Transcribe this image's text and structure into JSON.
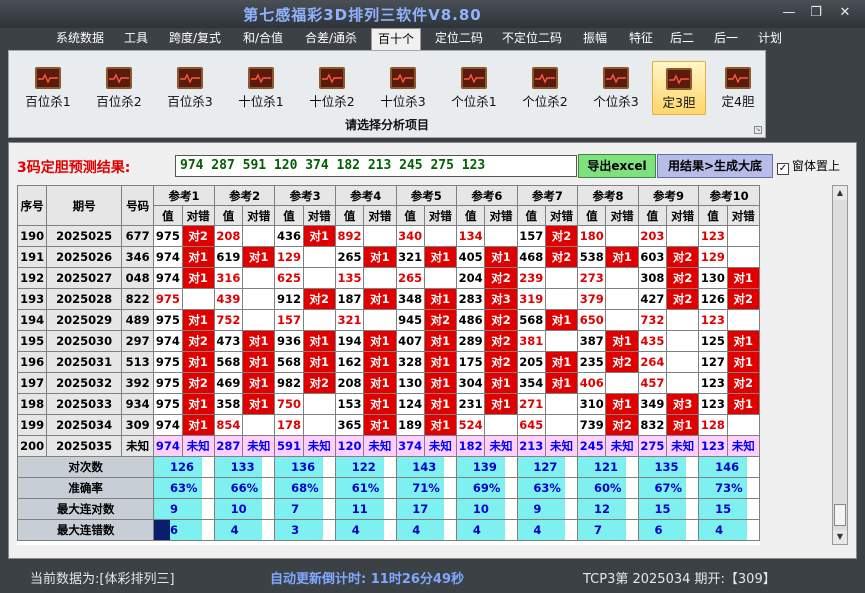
{
  "window": {
    "title": "第七感福彩3D排列三软件V8.80",
    "minimize": "—",
    "restore": "❐",
    "close": "✕"
  },
  "menu": [
    {
      "label": "系统数据"
    },
    {
      "label": "工具"
    },
    {
      "label": "跨度/复式"
    },
    {
      "label": "和/合值"
    },
    {
      "label": "合差/通杀"
    },
    {
      "label": "百十个",
      "active": true
    },
    {
      "label": "定位二码"
    },
    {
      "label": "不定位二码"
    },
    {
      "label": "振幅"
    },
    {
      "label": "特征"
    },
    {
      "label": "后二"
    },
    {
      "label": "后一"
    },
    {
      "label": "计划"
    }
  ],
  "ribbon": {
    "caption": "请选择分析项目",
    "buttons": [
      {
        "label": "百位杀1"
      },
      {
        "label": "百位杀2"
      },
      {
        "label": "百位杀3"
      },
      {
        "label": "十位杀1"
      },
      {
        "label": "十位杀2"
      },
      {
        "label": "十位杀3"
      },
      {
        "label": "个位杀1"
      },
      {
        "label": "个位杀2"
      },
      {
        "label": "个位杀3"
      },
      {
        "label": "定3胆",
        "active": true
      },
      {
        "label": "定4胆"
      }
    ]
  },
  "prediction": {
    "label": "3码定胆预测结果:",
    "result": "974 287 591 120 374 182 213 245 275 123",
    "export_button": "导出excel",
    "generate_button": "用结果>生成大底",
    "ontop_label": "窗体置上",
    "ontop_checked": "✓"
  },
  "table": {
    "headers": {
      "seq": "序号",
      "issue": "期号",
      "code": "号码",
      "value": "值",
      "check": "对错"
    },
    "refs": [
      "参考1",
      "参考2",
      "参考3",
      "参考4",
      "参考5",
      "参考6",
      "参考7",
      "参考8",
      "参考9",
      "参考10"
    ],
    "rows": [
      {
        "seq": "190",
        "issue": "2025025",
        "code": "677",
        "cells": [
          [
            "975",
            "对2"
          ],
          [
            "208",
            ""
          ],
          [
            "436",
            "对1"
          ],
          [
            "892",
            ""
          ],
          [
            "340",
            ""
          ],
          [
            "134",
            ""
          ],
          [
            "157",
            "对2"
          ],
          [
            "180",
            ""
          ],
          [
            "203",
            ""
          ],
          [
            "123",
            ""
          ]
        ]
      },
      {
        "seq": "191",
        "issue": "2025026",
        "code": "346",
        "cells": [
          [
            "974",
            "对1"
          ],
          [
            "619",
            "对1"
          ],
          [
            "129",
            ""
          ],
          [
            "265",
            "对1"
          ],
          [
            "321",
            "对1"
          ],
          [
            "405",
            "对1"
          ],
          [
            "468",
            "对2"
          ],
          [
            "538",
            "对1"
          ],
          [
            "603",
            "对2"
          ],
          [
            "129",
            ""
          ]
        ]
      },
      {
        "seq": "192",
        "issue": "2025027",
        "code": "048",
        "cells": [
          [
            "974",
            "对1"
          ],
          [
            "316",
            ""
          ],
          [
            "625",
            ""
          ],
          [
            "135",
            ""
          ],
          [
            "265",
            ""
          ],
          [
            "204",
            "对2"
          ],
          [
            "239",
            ""
          ],
          [
            "273",
            ""
          ],
          [
            "308",
            "对2"
          ],
          [
            "130",
            "对1"
          ]
        ]
      },
      {
        "seq": "193",
        "issue": "2025028",
        "code": "822",
        "cells": [
          [
            "975",
            ""
          ],
          [
            "439",
            ""
          ],
          [
            "912",
            "对2"
          ],
          [
            "187",
            "对1"
          ],
          [
            "348",
            "对1"
          ],
          [
            "283",
            "对3"
          ],
          [
            "319",
            ""
          ],
          [
            "379",
            ""
          ],
          [
            "427",
            "对2"
          ],
          [
            "126",
            "对2"
          ]
        ]
      },
      {
        "seq": "194",
        "issue": "2025029",
        "code": "489",
        "cells": [
          [
            "975",
            "对1"
          ],
          [
            "752",
            ""
          ],
          [
            "157",
            ""
          ],
          [
            "321",
            ""
          ],
          [
            "945",
            "对2"
          ],
          [
            "486",
            "对2"
          ],
          [
            "568",
            "对1"
          ],
          [
            "650",
            ""
          ],
          [
            "732",
            ""
          ],
          [
            "123",
            ""
          ]
        ]
      },
      {
        "seq": "195",
        "issue": "2025030",
        "code": "297",
        "cells": [
          [
            "974",
            "对2"
          ],
          [
            "473",
            "对1"
          ],
          [
            "936",
            "对1"
          ],
          [
            "194",
            "对1"
          ],
          [
            "407",
            "对1"
          ],
          [
            "289",
            "对2"
          ],
          [
            "381",
            ""
          ],
          [
            "387",
            "对1"
          ],
          [
            "435",
            ""
          ],
          [
            "125",
            "对1"
          ]
        ]
      },
      {
        "seq": "196",
        "issue": "2025031",
        "code": "513",
        "cells": [
          [
            "975",
            "对1"
          ],
          [
            "568",
            "对1"
          ],
          [
            "568",
            "对1"
          ],
          [
            "162",
            "对1"
          ],
          [
            "328",
            "对1"
          ],
          [
            "175",
            "对2"
          ],
          [
            "205",
            "对1"
          ],
          [
            "235",
            "对2"
          ],
          [
            "264",
            ""
          ],
          [
            "127",
            "对1"
          ]
        ]
      },
      {
        "seq": "197",
        "issue": "2025032",
        "code": "392",
        "cells": [
          [
            "975",
            "对2"
          ],
          [
            "469",
            "对1"
          ],
          [
            "982",
            "对2"
          ],
          [
            "208",
            "对1"
          ],
          [
            "130",
            "对1"
          ],
          [
            "304",
            "对1"
          ],
          [
            "354",
            "对1"
          ],
          [
            "406",
            ""
          ],
          [
            "457",
            ""
          ],
          [
            "123",
            "对2"
          ]
        ]
      },
      {
        "seq": "198",
        "issue": "2025033",
        "code": "934",
        "cells": [
          [
            "975",
            "对1"
          ],
          [
            "358",
            "对1"
          ],
          [
            "750",
            ""
          ],
          [
            "153",
            "对1"
          ],
          [
            "124",
            "对1"
          ],
          [
            "231",
            "对1"
          ],
          [
            "271",
            ""
          ],
          [
            "310",
            "对1"
          ],
          [
            "349",
            "对3"
          ],
          [
            "123",
            "对1"
          ]
        ]
      },
      {
        "seq": "199",
        "issue": "2025034",
        "code": "309",
        "cells": [
          [
            "974",
            "对1"
          ],
          [
            "854",
            ""
          ],
          [
            "178",
            ""
          ],
          [
            "365",
            "对1"
          ],
          [
            "189",
            "对1"
          ],
          [
            "524",
            ""
          ],
          [
            "645",
            ""
          ],
          [
            "739",
            "对2"
          ],
          [
            "832",
            "对1"
          ],
          [
            "128",
            ""
          ]
        ]
      }
    ],
    "unknown_row": {
      "seq": "200",
      "issue": "2025035",
      "code": "未知",
      "cells": [
        [
          "974",
          "未知"
        ],
        [
          "287",
          "未知"
        ],
        [
          "591",
          "未知"
        ],
        [
          "120",
          "未知"
        ],
        [
          "374",
          "未知"
        ],
        [
          "182",
          "未知"
        ],
        [
          "213",
          "未知"
        ],
        [
          "245",
          "未知"
        ],
        [
          "275",
          "未知"
        ],
        [
          "123",
          "未知"
        ]
      ]
    },
    "stats": [
      {
        "label": "对次数",
        "values": [
          "126",
          "133",
          "136",
          "122",
          "143",
          "139",
          "127",
          "121",
          "135",
          "146"
        ]
      },
      {
        "label": "准确率",
        "values": [
          "63%",
          "66%",
          "68%",
          "61%",
          "71%",
          "69%",
          "63%",
          "60%",
          "67%",
          "73%"
        ]
      },
      {
        "label": "最大连对数",
        "values": [
          "9",
          "10",
          "7",
          "11",
          "17",
          "10",
          "9",
          "12",
          "15",
          "15"
        ]
      },
      {
        "label": "最大连错数",
        "values": [
          "6",
          "4",
          "3",
          "4",
          "4",
          "4",
          "4",
          "7",
          "6",
          "4"
        ]
      }
    ]
  },
  "status": {
    "current_data": "当前数据为:[体彩排列三]",
    "countdown": "自动更新倒计时: 11时26分49秒",
    "draw_info": "TCP3第 2025034 期开:【309】"
  }
}
